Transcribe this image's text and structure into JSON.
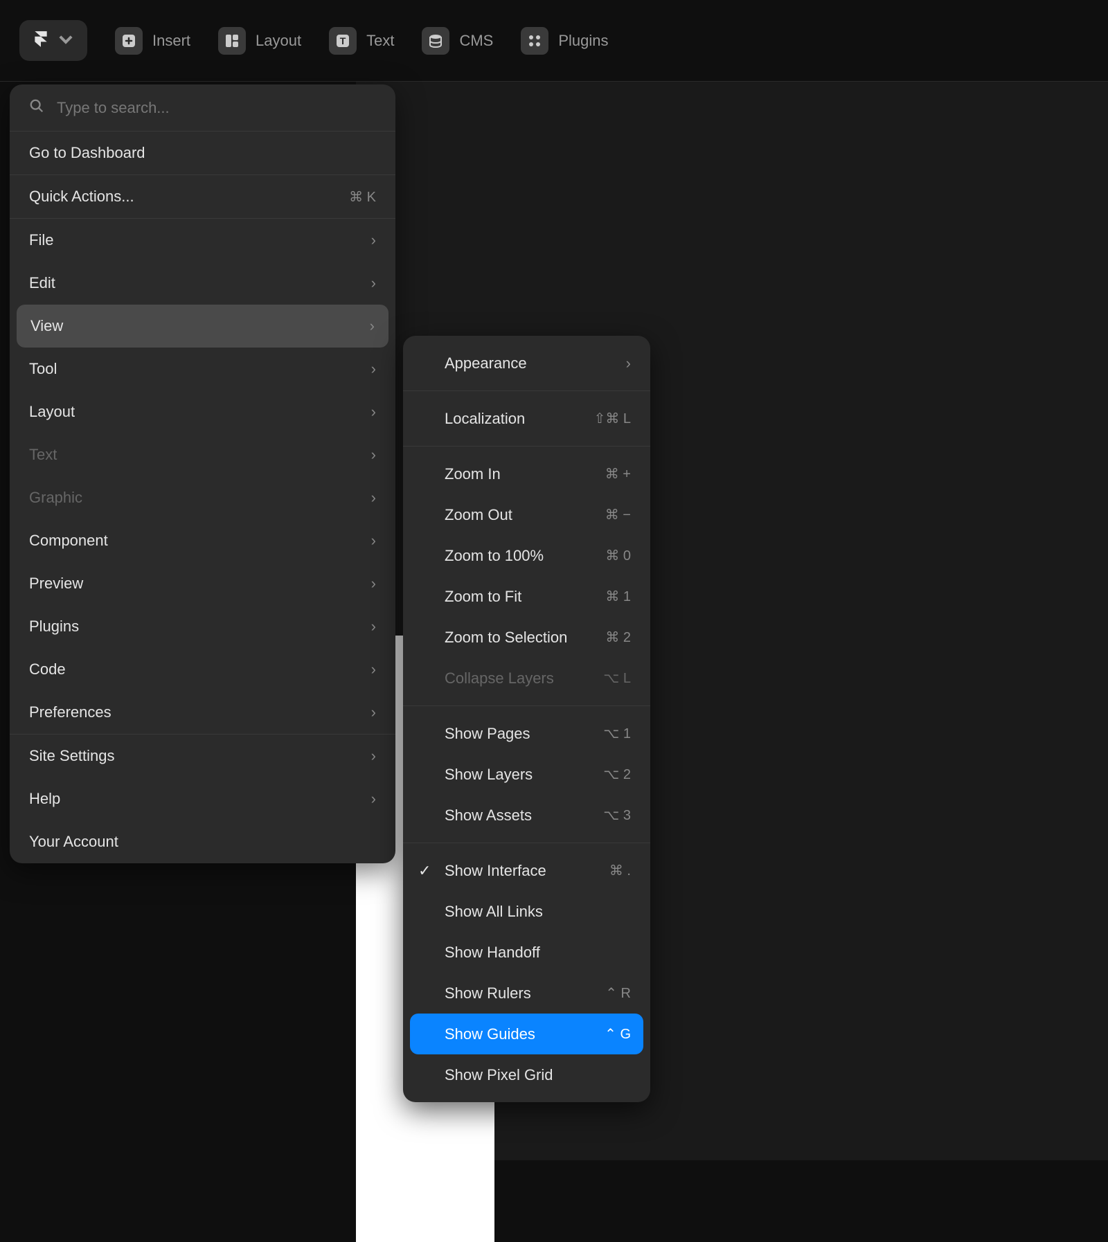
{
  "toolbar": {
    "insert": "Insert",
    "layout": "Layout",
    "text": "Text",
    "cms": "CMS",
    "plugins": "Plugins"
  },
  "search": {
    "placeholder": "Type to search..."
  },
  "menu": {
    "dashboard": "Go to Dashboard",
    "quickActions": {
      "label": "Quick Actions...",
      "shortcut": "⌘ K"
    },
    "file": "File",
    "edit": "Edit",
    "view": "View",
    "tool": "Tool",
    "layout": "Layout",
    "text": "Text",
    "graphic": "Graphic",
    "component": "Component",
    "preview": "Preview",
    "plugins": "Plugins",
    "code": "Code",
    "preferences": "Preferences",
    "siteSettings": "Site Settings",
    "help": "Help",
    "yourAccount": "Your Account"
  },
  "submenu": {
    "appearance": "Appearance",
    "localization": {
      "label": "Localization",
      "shortcut": "⇧⌘ L"
    },
    "zoomIn": {
      "label": "Zoom In",
      "shortcut": "⌘ +"
    },
    "zoomOut": {
      "label": "Zoom Out",
      "shortcut": "⌘ −"
    },
    "zoom100": {
      "label": "Zoom to 100%",
      "shortcut": "⌘ 0"
    },
    "zoomFit": {
      "label": "Zoom to Fit",
      "shortcut": "⌘ 1"
    },
    "zoomSelection": {
      "label": "Zoom to Selection",
      "shortcut": "⌘ 2"
    },
    "collapseLayers": {
      "label": "Collapse Layers",
      "shortcut": "⌥ L"
    },
    "showPages": {
      "label": "Show Pages",
      "shortcut": "⌥ 1"
    },
    "showLayers": {
      "label": "Show Layers",
      "shortcut": "⌥ 2"
    },
    "showAssets": {
      "label": "Show Assets",
      "shortcut": "⌥ 3"
    },
    "showInterface": {
      "label": "Show Interface",
      "shortcut": "⌘ ."
    },
    "showAllLinks": "Show All Links",
    "showHandoff": "Show Handoff",
    "showRulers": {
      "label": "Show Rulers",
      "shortcut": "⌃ R"
    },
    "showGuides": {
      "label": "Show Guides",
      "shortcut": "⌃ G"
    },
    "showPixelGrid": "Show Pixel Grid"
  }
}
